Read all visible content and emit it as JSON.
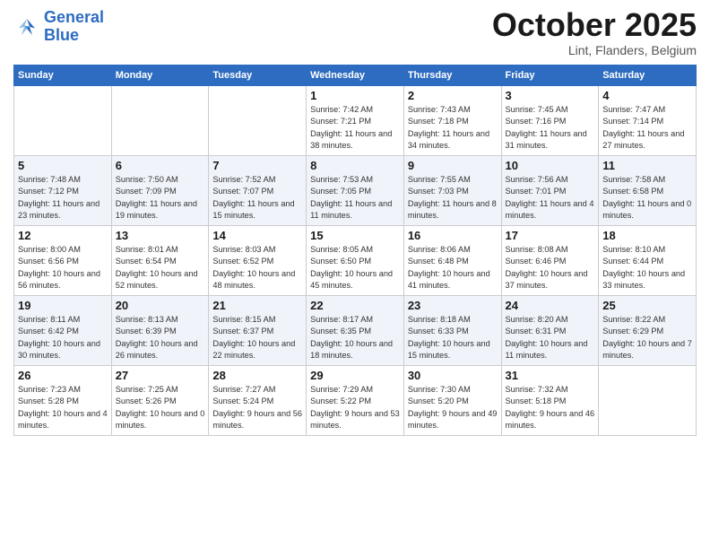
{
  "header": {
    "logo_line1": "General",
    "logo_line2": "Blue",
    "month": "October 2025",
    "location": "Lint, Flanders, Belgium"
  },
  "weekdays": [
    "Sunday",
    "Monday",
    "Tuesday",
    "Wednesday",
    "Thursday",
    "Friday",
    "Saturday"
  ],
  "weeks": [
    {
      "shaded": false,
      "days": [
        {
          "num": "",
          "info": ""
        },
        {
          "num": "",
          "info": ""
        },
        {
          "num": "",
          "info": ""
        },
        {
          "num": "1",
          "info": "Sunrise: 7:42 AM\nSunset: 7:21 PM\nDaylight: 11 hours\nand 38 minutes."
        },
        {
          "num": "2",
          "info": "Sunrise: 7:43 AM\nSunset: 7:18 PM\nDaylight: 11 hours\nand 34 minutes."
        },
        {
          "num": "3",
          "info": "Sunrise: 7:45 AM\nSunset: 7:16 PM\nDaylight: 11 hours\nand 31 minutes."
        },
        {
          "num": "4",
          "info": "Sunrise: 7:47 AM\nSunset: 7:14 PM\nDaylight: 11 hours\nand 27 minutes."
        }
      ]
    },
    {
      "shaded": true,
      "days": [
        {
          "num": "5",
          "info": "Sunrise: 7:48 AM\nSunset: 7:12 PM\nDaylight: 11 hours\nand 23 minutes."
        },
        {
          "num": "6",
          "info": "Sunrise: 7:50 AM\nSunset: 7:09 PM\nDaylight: 11 hours\nand 19 minutes."
        },
        {
          "num": "7",
          "info": "Sunrise: 7:52 AM\nSunset: 7:07 PM\nDaylight: 11 hours\nand 15 minutes."
        },
        {
          "num": "8",
          "info": "Sunrise: 7:53 AM\nSunset: 7:05 PM\nDaylight: 11 hours\nand 11 minutes."
        },
        {
          "num": "9",
          "info": "Sunrise: 7:55 AM\nSunset: 7:03 PM\nDaylight: 11 hours\nand 8 minutes."
        },
        {
          "num": "10",
          "info": "Sunrise: 7:56 AM\nSunset: 7:01 PM\nDaylight: 11 hours\nand 4 minutes."
        },
        {
          "num": "11",
          "info": "Sunrise: 7:58 AM\nSunset: 6:58 PM\nDaylight: 11 hours\nand 0 minutes."
        }
      ]
    },
    {
      "shaded": false,
      "days": [
        {
          "num": "12",
          "info": "Sunrise: 8:00 AM\nSunset: 6:56 PM\nDaylight: 10 hours\nand 56 minutes."
        },
        {
          "num": "13",
          "info": "Sunrise: 8:01 AM\nSunset: 6:54 PM\nDaylight: 10 hours\nand 52 minutes."
        },
        {
          "num": "14",
          "info": "Sunrise: 8:03 AM\nSunset: 6:52 PM\nDaylight: 10 hours\nand 48 minutes."
        },
        {
          "num": "15",
          "info": "Sunrise: 8:05 AM\nSunset: 6:50 PM\nDaylight: 10 hours\nand 45 minutes."
        },
        {
          "num": "16",
          "info": "Sunrise: 8:06 AM\nSunset: 6:48 PM\nDaylight: 10 hours\nand 41 minutes."
        },
        {
          "num": "17",
          "info": "Sunrise: 8:08 AM\nSunset: 6:46 PM\nDaylight: 10 hours\nand 37 minutes."
        },
        {
          "num": "18",
          "info": "Sunrise: 8:10 AM\nSunset: 6:44 PM\nDaylight: 10 hours\nand 33 minutes."
        }
      ]
    },
    {
      "shaded": true,
      "days": [
        {
          "num": "19",
          "info": "Sunrise: 8:11 AM\nSunset: 6:42 PM\nDaylight: 10 hours\nand 30 minutes."
        },
        {
          "num": "20",
          "info": "Sunrise: 8:13 AM\nSunset: 6:39 PM\nDaylight: 10 hours\nand 26 minutes."
        },
        {
          "num": "21",
          "info": "Sunrise: 8:15 AM\nSunset: 6:37 PM\nDaylight: 10 hours\nand 22 minutes."
        },
        {
          "num": "22",
          "info": "Sunrise: 8:17 AM\nSunset: 6:35 PM\nDaylight: 10 hours\nand 18 minutes."
        },
        {
          "num": "23",
          "info": "Sunrise: 8:18 AM\nSunset: 6:33 PM\nDaylight: 10 hours\nand 15 minutes."
        },
        {
          "num": "24",
          "info": "Sunrise: 8:20 AM\nSunset: 6:31 PM\nDaylight: 10 hours\nand 11 minutes."
        },
        {
          "num": "25",
          "info": "Sunrise: 8:22 AM\nSunset: 6:29 PM\nDaylight: 10 hours\nand 7 minutes."
        }
      ]
    },
    {
      "shaded": false,
      "days": [
        {
          "num": "26",
          "info": "Sunrise: 7:23 AM\nSunset: 5:28 PM\nDaylight: 10 hours\nand 4 minutes."
        },
        {
          "num": "27",
          "info": "Sunrise: 7:25 AM\nSunset: 5:26 PM\nDaylight: 10 hours\nand 0 minutes."
        },
        {
          "num": "28",
          "info": "Sunrise: 7:27 AM\nSunset: 5:24 PM\nDaylight: 9 hours\nand 56 minutes."
        },
        {
          "num": "29",
          "info": "Sunrise: 7:29 AM\nSunset: 5:22 PM\nDaylight: 9 hours\nand 53 minutes."
        },
        {
          "num": "30",
          "info": "Sunrise: 7:30 AM\nSunset: 5:20 PM\nDaylight: 9 hours\nand 49 minutes."
        },
        {
          "num": "31",
          "info": "Sunrise: 7:32 AM\nSunset: 5:18 PM\nDaylight: 9 hours\nand 46 minutes."
        },
        {
          "num": "",
          "info": ""
        }
      ]
    }
  ]
}
